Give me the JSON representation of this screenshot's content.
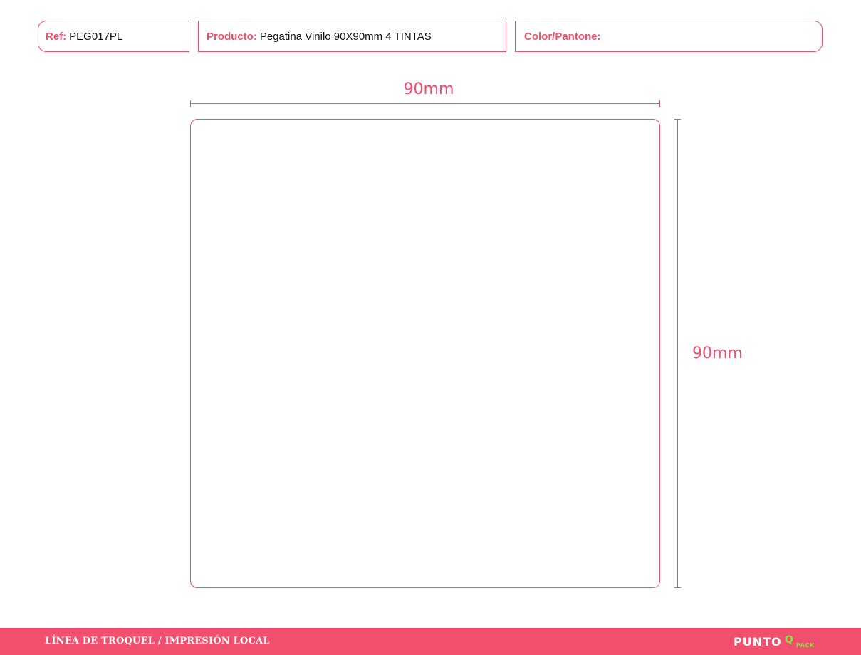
{
  "header": {
    "ref": {
      "label": "Ref:",
      "value": "PEG017PL"
    },
    "product": {
      "label": "Producto:",
      "value": "Pegatina Vinilo 90X90mm 4 TINTAS"
    },
    "color": {
      "label": "Color/Pantone:",
      "value": ""
    }
  },
  "dimensions": {
    "width_label": "90mm",
    "height_label": "90mm"
  },
  "footer": {
    "text": "LÍNEA DE TROQUEL / IMPRESIÓN LOCAL",
    "logo_main": "PUNTO",
    "logo_q": "Q",
    "logo_sub": "PACK"
  },
  "colors": {
    "accent": "#f0506e",
    "logo_green": "#8fe03a"
  }
}
